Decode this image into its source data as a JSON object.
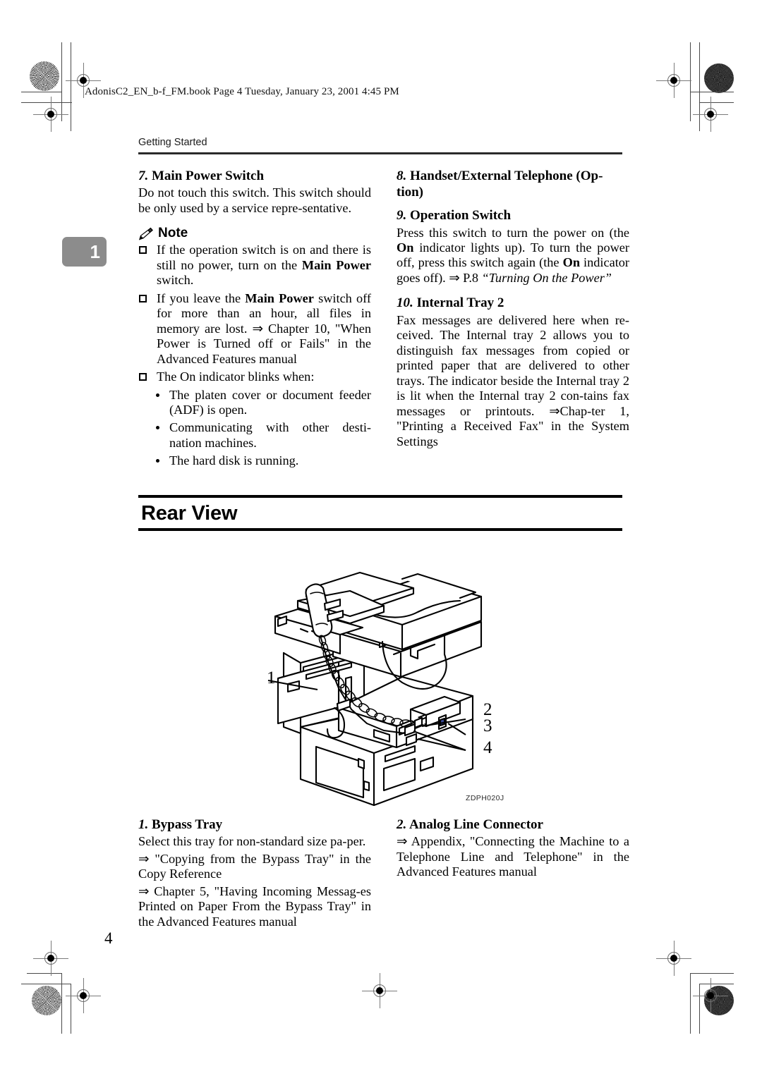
{
  "print_header": "AdonisC2_EN_b-f_FM.book  Page 4  Tuesday, January 23, 2001  4:45 PM",
  "running_head": "Getting Started",
  "chapter_tab": "1",
  "page_number": "4",
  "left_column": {
    "section7": {
      "num": "7.",
      "title": "Main Power Switch",
      "paragraph": "Do not touch this switch. This switch should be only used by a service repre-sentative."
    },
    "note": {
      "label": "Note",
      "icon": "pencil-icon",
      "items": [
        {
          "pre": "If the operation switch is on and there is still no power, turn on the ",
          "bold": "Main Power",
          "post": " switch."
        },
        {
          "pre": "If you leave the ",
          "bold": "Main Power",
          "post": " switch off for more than an hour, all files in memory are lost. ⇒ Chapter 10, \"When Power is Turned off or Fails\" in the Advanced Features manual"
        },
        {
          "pre": "The On indicator blinks when:",
          "bold": "",
          "post": ""
        }
      ],
      "sub_bullets": [
        "The platen cover or document feeder (ADF) is open.",
        "Communicating with other desti-nation machines.",
        "The hard disk is running."
      ]
    }
  },
  "right_column": {
    "section8": {
      "num": "8.",
      "title": "Handset/External Telephone (Op-tion)"
    },
    "section9": {
      "num": "9.",
      "title": "Operation Switch",
      "text_a": "Press this switch to turn the power on (the ",
      "bold_a": "On",
      "text_b": " indicator lights up). To turn the power off, press this switch again (the ",
      "bold_b": "On",
      "text_c": " indicator goes off). ⇒ P.8 ",
      "italic_ref": "“Turning On the Power”"
    },
    "section10": {
      "num": "10.",
      "title": "Internal Tray 2",
      "paragraph": "Fax messages are delivered here when re-ceived. The Internal tray 2 allows you to distinguish fax messages from copied or printed paper that are delivered to other trays. The indicator beside the Internal tray 2 is lit when the Internal tray 2 con-tains fax messages or printouts. ⇒Chap-ter 1, \"Printing a Received Fax\" in the System Settings"
    }
  },
  "section_banner": {
    "title": "Rear View"
  },
  "figure": {
    "id_label": "ZDPH020J",
    "alt": "rear view line drawing of multifunction copier with handset",
    "callouts": [
      "1",
      "2",
      "3",
      "4"
    ]
  },
  "bottom_left": {
    "num": "1.",
    "title": "Bypass Tray",
    "p1": "Select this tray for non-standard size pa-per.",
    "p2": "⇒ \"Copying from the Bypass Tray\" in the Copy Reference",
    "p3": "⇒ Chapter 5, \"Having Incoming Messag-es Printed on Paper From the Bypass Tray\" in the Advanced Features manual"
  },
  "bottom_right": {
    "num": "2.",
    "title": "Analog Line Connector",
    "p1": "⇒ Appendix, \"Connecting the Machine to a Telephone Line and Telephone\" in the Advanced Features manual"
  }
}
